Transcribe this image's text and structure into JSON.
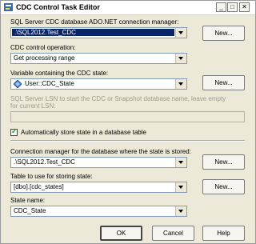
{
  "window": {
    "title": "CDC Control Task Editor",
    "minimize": "_",
    "maximize": "□",
    "close": "✕"
  },
  "connection": {
    "label": "SQL Server CDC database ADO.NET connection manager:",
    "value": ".\\SQL2012.Test_CDC",
    "new_label": "New..."
  },
  "operation": {
    "label": "CDC control operation:",
    "value": "Get processing range"
  },
  "variable": {
    "label": "Variable containing the CDC state:",
    "value": "User::CDC_State",
    "new_label": "New..."
  },
  "lsn": {
    "label": "SQL Server LSN to start the CDC or Snapshot database name, leave empty for current LSN:"
  },
  "auto_store": {
    "label": "Automatically store state in a database table",
    "checked": true
  },
  "state_conn": {
    "label": "Connection manager for the database where the state is stored:",
    "value": ".\\SQL2012.Test_CDC",
    "new_label": "New..."
  },
  "table": {
    "label": "Table to use for storing state:",
    "value": "[dbo].[cdc_states]",
    "new_label": "New..."
  },
  "state_name": {
    "label": "State name:",
    "value": "CDC_State"
  },
  "buttons": {
    "ok": "OK",
    "cancel": "Cancel",
    "help": "Help"
  }
}
